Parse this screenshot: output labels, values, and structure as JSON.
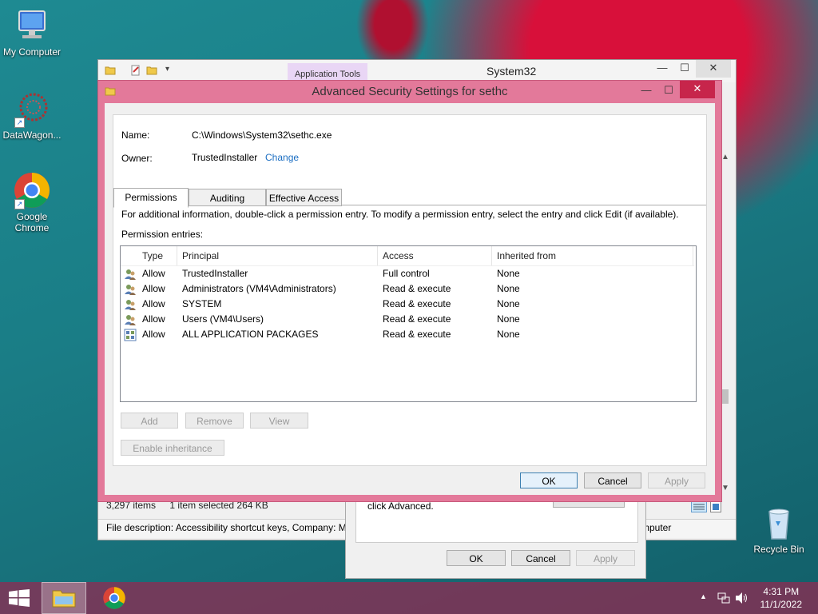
{
  "desktop": {
    "icons": [
      {
        "label": "My Computer"
      },
      {
        "label": "DataWagon..."
      },
      {
        "label": "Google Chrome"
      },
      {
        "label": "Recycle Bin"
      }
    ]
  },
  "explorer": {
    "app_tools": "Application Tools",
    "title": "System32",
    "status_items": "3,297 items",
    "status_selected": "1 item selected  264 KB",
    "description": "File description: Accessibility shortcut keys, Company: M",
    "description_right": "mputer"
  },
  "props_dialog": {
    "text": "click Advanced.",
    "ok": "OK",
    "cancel": "Cancel",
    "apply": "Apply"
  },
  "dialog": {
    "title": "Advanced Security Settings for sethc",
    "name_label": "Name:",
    "name_value": "C:\\Windows\\System32\\sethc.exe",
    "owner_label": "Owner:",
    "owner_value": "TrustedInstaller",
    "change_link": "Change",
    "tabs": [
      "Permissions",
      "Auditing",
      "Effective Access"
    ],
    "info": "For additional information, double-click a permission entry. To modify a permission entry, select the entry and click Edit (if available).",
    "entries_label": "Permission entries:",
    "columns": [
      "Type",
      "Principal",
      "Access",
      "Inherited from"
    ],
    "rows": [
      {
        "type": "Allow",
        "principal": "TrustedInstaller",
        "access": "Full control",
        "inherited": "None"
      },
      {
        "type": "Allow",
        "principal": "Administrators (VM4\\Administrators)",
        "access": "Read & execute",
        "inherited": "None"
      },
      {
        "type": "Allow",
        "principal": "SYSTEM",
        "access": "Read & execute",
        "inherited": "None"
      },
      {
        "type": "Allow",
        "principal": "Users (VM4\\Users)",
        "access": "Read & execute",
        "inherited": "None"
      },
      {
        "type": "Allow",
        "principal": "ALL APPLICATION PACKAGES",
        "access": "Read & execute",
        "inherited": "None"
      }
    ],
    "add": "Add",
    "remove": "Remove",
    "view": "View",
    "enable_inheritance": "Enable inheritance",
    "ok": "OK",
    "cancel": "Cancel",
    "apply": "Apply"
  },
  "taskbar": {
    "time": "4:31 PM",
    "date": "11/1/2022"
  }
}
